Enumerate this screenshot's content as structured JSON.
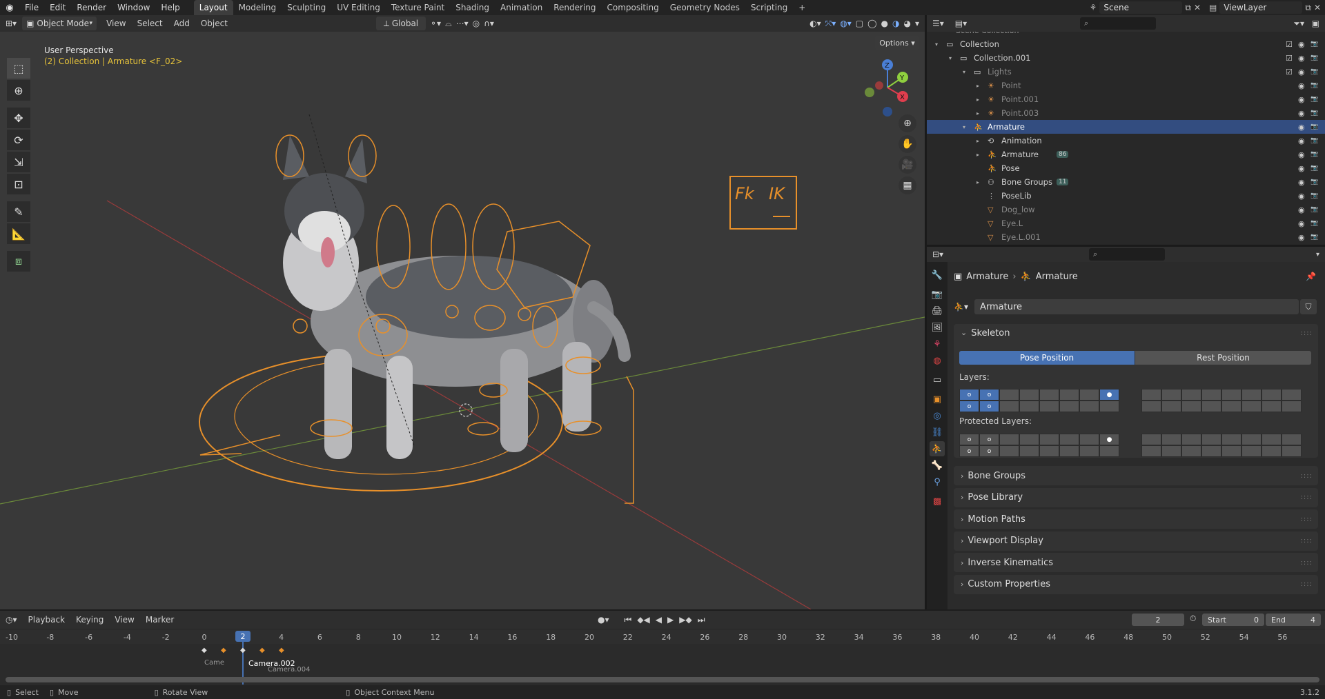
{
  "topbar": {
    "menus": [
      "File",
      "Edit",
      "Render",
      "Window",
      "Help"
    ],
    "workspaces": [
      "Layout",
      "Modeling",
      "Sculpting",
      "UV Editing",
      "Texture Paint",
      "Shading",
      "Animation",
      "Rendering",
      "Compositing",
      "Geometry Nodes",
      "Scripting"
    ],
    "active_workspace": "Layout",
    "scene": "Scene",
    "view_layer": "ViewLayer"
  },
  "viewport": {
    "mode": "Object Mode",
    "menus": [
      "View",
      "Select",
      "Add",
      "Object"
    ],
    "transform_orientation": "Global",
    "options_label": "Options",
    "overlay_title": "User Perspective",
    "overlay_subtitle": "(2) Collection | Armature <F_02>",
    "fk_label": "Fk",
    "ik_label": "IK",
    "gizmo_x": "X",
    "gizmo_y": "Y",
    "gizmo_z": "Z"
  },
  "outliner": {
    "header_partial": "Scene Collection",
    "rows": [
      {
        "label": "Collection",
        "depth": 1,
        "icon": "collection-icon"
      },
      {
        "label": "Collection.001",
        "depth": 2,
        "icon": "collection-icon"
      },
      {
        "label": "Lights",
        "depth": 3,
        "icon": "collection-icon",
        "dim": true
      },
      {
        "label": "Point",
        "depth": 4,
        "icon": "light-icon",
        "dim": true
      },
      {
        "label": "Point.001",
        "depth": 4,
        "icon": "light-icon",
        "dim": true
      },
      {
        "label": "Point.003",
        "depth": 4,
        "icon": "light-icon",
        "dim": true
      },
      {
        "label": "Armature",
        "depth": 3,
        "icon": "armature-icon",
        "selected": true
      },
      {
        "label": "Animation",
        "depth": 4,
        "icon": "animation-icon"
      },
      {
        "label": "Armature",
        "depth": 4,
        "icon": "armature-data-icon",
        "badge": "86"
      },
      {
        "label": "Pose",
        "depth": 4,
        "icon": "pose-icon"
      },
      {
        "label": "Bone Groups",
        "depth": 4,
        "icon": "bone-groups-icon",
        "badge": "11"
      },
      {
        "label": "PoseLib",
        "depth": 4,
        "icon": "poselib-icon"
      },
      {
        "label": "Dog_low",
        "depth": 4,
        "icon": "mesh-icon",
        "dim": true
      },
      {
        "label": "Eye.L",
        "depth": 4,
        "icon": "mesh-icon",
        "dim": true
      },
      {
        "label": "Eye.L.001",
        "depth": 4,
        "icon": "mesh-icon",
        "dim": true
      }
    ]
  },
  "properties": {
    "breadcrumb": [
      "Armature",
      "Armature"
    ],
    "datablock_name": "Armature",
    "skeleton_title": "Skeleton",
    "pose_position": "Pose Position",
    "rest_position": "Rest Position",
    "layers_label": "Layers:",
    "protected_layers_label": "Protected Layers:",
    "collapsed_panels": [
      "Bone Groups",
      "Pose Library",
      "Motion Paths",
      "Viewport Display",
      "Inverse Kinematics",
      "Custom Properties"
    ]
  },
  "timeline": {
    "menus": [
      "Playback",
      "Keying",
      "View",
      "Marker"
    ],
    "current_frame": "2",
    "start_label": "Start",
    "start_value": "0",
    "end_label": "End",
    "end_value": "4",
    "ticks": [
      "-10",
      "-8",
      "-6",
      "-4",
      "-2",
      "0",
      "2",
      "4",
      "6",
      "8",
      "10",
      "12",
      "14",
      "16",
      "18",
      "20",
      "22",
      "24",
      "26",
      "28",
      "30",
      "32",
      "34",
      "36",
      "38",
      "40",
      "42",
      "44",
      "46",
      "48",
      "50",
      "52",
      "54",
      "56"
    ],
    "marker_label_a": "Camera.002",
    "marker_label_b": "Camera.004",
    "marker_label_c": "Came"
  },
  "statusbar": {
    "select": "Select",
    "move": "Move",
    "rotate": "Rotate View",
    "context": "Object Context Menu",
    "version": "3.1.2"
  },
  "colors": {
    "accent": "#4772b3",
    "selection": "#334d80",
    "rig_orange": "#e8902a",
    "subtitle_yellow": "#e8c43a"
  }
}
